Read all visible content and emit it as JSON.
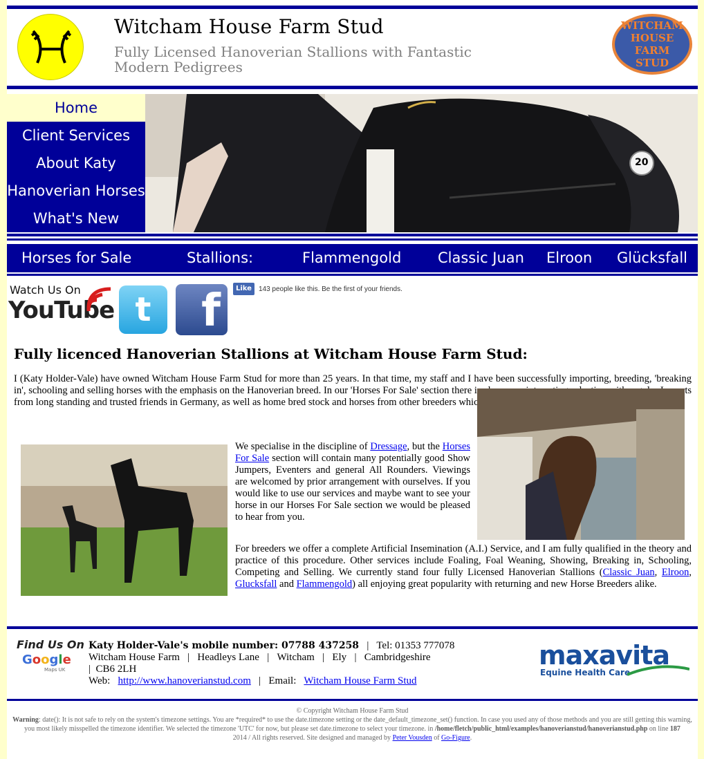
{
  "header": {
    "title": "Witcham House Farm Stud",
    "tagline": "Fully Licensed Hanoverian Stallions with Fantastic Modern Pedigrees",
    "right_logo_text": [
      "WITCHAM",
      "HOUSE FARM",
      "STUD"
    ]
  },
  "nav": {
    "items": [
      {
        "label": "Home",
        "active": true
      },
      {
        "label": "Client Services"
      },
      {
        "label": "About Katy"
      },
      {
        "label": "Hanoverian Horses"
      },
      {
        "label": "What's New"
      }
    ]
  },
  "hero": {
    "number_tag": "20"
  },
  "horse_bar": {
    "items": [
      "Horses for Sale",
      "Stallions:",
      "Flammengold",
      "Classic Juan",
      "Elroon",
      "Glücksfall"
    ]
  },
  "social": {
    "youtube_top": "Watch Us On",
    "youtube_brand": "YouTube",
    "twitter_glyph": "t",
    "facebook_glyph": "f",
    "fb_like_label": "Like",
    "fb_like_text": "143 people like this. Be the first of your friends."
  },
  "content": {
    "heading": "Fully licenced Hanoverian Stallions at Witcham House Farm Stud:",
    "para1": "I (Katy Holder-Vale) have owned Witcham House Farm Stud for more than 25 years. In that time, my staff and I have been successfully importing, breeding, 'breaking in', schooling and selling horses with the emphasis on the Hanoverian breed. In our 'Horses For Sale' section there is always an interesting selection with regular Imports from long standing and trusted friends in Germany, as well as home bred stock and horses from other breeders which we have broken and / or schooled.",
    "para2_a": "We specialise in the discipline of ",
    "para2_link1": "Dressage",
    "para2_b": ", but the ",
    "para2_link2": "Horses For Sale",
    "para2_c": " section will contain many potentially good Show Jumpers, Eventers and general All Rounders. Viewings are welcomed by prior arrangement with ourselves. If you would like to use our services and maybe want to see your horse in our Horses For Sale section we would be pleased to hear from you.",
    "para3_a": "For breeders we offer a complete Artificial Insemination (A.I.) Service, and I am fully qualified in the theory and practice of this procedure. Other services include Foaling, Foal Weaning, Showing, Breaking in, Schooling, Competing and Selling. We currently stand four fully Licensed Hanoverian Stallions (",
    "para3_link1": "Classic Juan",
    "para3_sep1": ", ",
    "para3_link2": "Elroon",
    "para3_sep2": ", ",
    "para3_link3": "Glucksfall",
    "para3_and": " and ",
    "para3_link4": "Flammengold",
    "para3_b": ") all enjoying great popularity with returning and new Horse Breeders alike."
  },
  "footer": {
    "findus_title": "Find Us On",
    "findus_google": "Google",
    "findus_sub": "Maps UK",
    "mobile_label": "Katy Holder-Vale's mobile number: 07788 437258",
    "sep": "|",
    "tel": "Tel: 01353 777078",
    "address": [
      "Witcham House Farm",
      "Headleys Lane",
      "Witcham",
      "Ely",
      "Cambridgeshire"
    ],
    "postcode": "CB6 2LH",
    "web_label": "Web:",
    "web_link": "http://www.hanoverianstud.com",
    "email_label": "Email:",
    "email_link": "Witcham House Farm Stud",
    "sponsor_name": "maxavita",
    "sponsor_sub": "Equine Health Care"
  },
  "legal": {
    "copyright": "© Copyright Witcham House Farm Stud",
    "warning_label": "Warning",
    "warning_text": ": date(): It is not safe to rely on the system's timezone settings. You are *required* to use the date.timezone setting or the date_default_timezone_set() function. In case you used any of those methods and you are still getting this warning, you most likely misspelled the timezone identifier. We selected the timezone 'UTC' for now, but please set date.timezone to select your timezone. in ",
    "warning_path": "/home/fletch/public_html/examples/hanoverianstud/hanoverianstud.php",
    "warning_line_label": " on line ",
    "warning_line": "187",
    "rights": "2014 / All rights reserved. Site designed and managed by ",
    "designer": "Peter Vousden",
    "of": " of ",
    "company": "Go-Figure",
    "end": "."
  },
  "colors": {
    "brand_blue": "#000099",
    "background": "#ffffcc",
    "logo_yellow": "#ffff00"
  }
}
